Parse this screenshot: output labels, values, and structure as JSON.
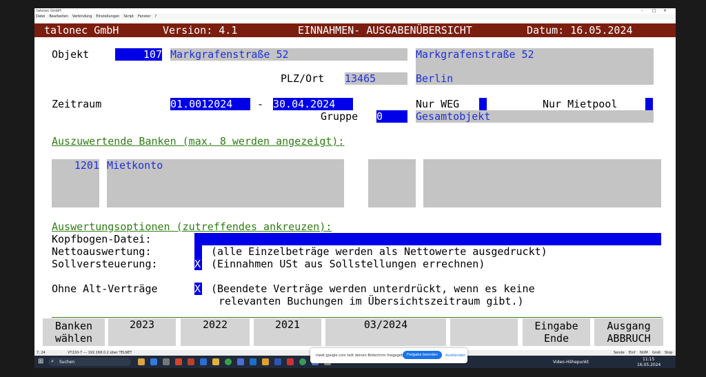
{
  "window": {
    "title": "talonec GmbH",
    "menu": [
      "Datei",
      "Bearbeiten",
      "Verbindung",
      "Einstellungen",
      "Skript",
      "Fenster",
      "?"
    ]
  },
  "header": {
    "company": "talonec GmbH",
    "version": "Version: 4.1",
    "title": "EINNAHMEN- AUSGABENÜBERSICHT",
    "date": "Datum: 16.05.2024"
  },
  "form": {
    "objekt_label": "Objekt",
    "objekt_nr": "107",
    "objekt_street": "Markgrafenstraße 52",
    "objekt_street2": "Markgrafenstraße 52",
    "plz_label": "PLZ/Ort",
    "plz": "13465",
    "ort": "Berlin",
    "zeitraum_label": "Zeitraum",
    "from": "01.0012024",
    "dash": "-",
    "to": "30.04.2024",
    "nur_weg_label": "Nur WEG",
    "nur_mietpool_label": "Nur Mietpool",
    "gruppe_label": "Gruppe",
    "gruppe_value": "0",
    "gruppe_text": "Gesamtobjekt"
  },
  "banks": {
    "heading": "Auszuwertende Banken (max. 8 werden angezeigt):",
    "items": [
      {
        "nr": "1201",
        "name": "Mietkonto"
      }
    ]
  },
  "options": {
    "heading": "Auswertungsoptionen (zutreffendes ankreuzen):",
    "kopfbogen_label": "Kopfbogen-Datei:",
    "netto_label": "Nettoauswertung:",
    "netto_desc": "(alle Einzelbeträge werden als Nettowerte ausgedruckt)",
    "soll_label": "Sollversteuerung:",
    "soll_value": "X",
    "soll_desc": "(Einnahmen USt aus Sollstellungen errechnen)",
    "alt_label": "Ohne Alt-Verträge",
    "alt_value": "X",
    "alt_desc1": "(Beendete Verträge werden unterdrückt, wenn es keine",
    "alt_desc2": "relevanten Buchungen im Übersichtszeitraum gibt.)"
  },
  "fkeys": {
    "banken1": "Banken",
    "banken2": "wählen",
    "y2023": "2023",
    "y2022": "2022",
    "y2021": "2021",
    "m": "03/2024",
    "eingabe1": "Eingabe",
    "eingabe2": "Ende",
    "ausgang1": "Ausgang",
    "ausgang2": "ABBRUCH"
  },
  "status": {
    "pos": "7, 24",
    "conn": "VT220-7 --- 192.168.0.2 über TELNET",
    "keys": [
      "Sende",
      "Einf",
      "NUM",
      "Groß",
      "Stop"
    ]
  },
  "taskbar": {
    "search": "Suchen",
    "video": "Video-Höhepunkt",
    "time": "11:15",
    "date": "16.05.2024"
  },
  "share": {
    "text": "meet.google.com teilt deinen Bildschirm freigegeben.",
    "stop": "Freigabe beenden",
    "hide": "Ausblenden"
  },
  "colors": {
    "header_bg": "#7b1e10",
    "field_blue": "#0000e8",
    "text_blue": "#1e2fd8",
    "field_gray": "#c4c4c4",
    "section_green": "#2e7d12"
  }
}
